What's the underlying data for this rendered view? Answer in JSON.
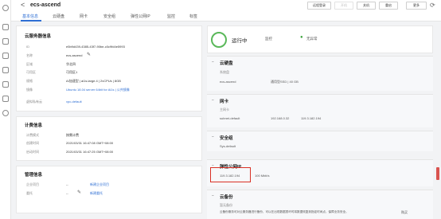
{
  "header": {
    "back": "<",
    "title": "ecs-ascend",
    "buttons": [
      "远程登录",
      "开机",
      "关机",
      "重启",
      "更多"
    ]
  },
  "tabs": [
    "基本信息",
    "云硬盘",
    "网卡",
    "安全组",
    "弹性公网IP",
    "监控",
    "标签"
  ],
  "server_info": {
    "heading": "云服务器信息",
    "rows": [
      {
        "label": "ID",
        "value": "e5b9d439-4385-43f7-90be-c0c9fd4e5993"
      },
      {
        "label": "名称",
        "value": "ecs-ascend"
      },
      {
        "label": "区域",
        "value": "华北四"
      },
      {
        "label": "可用区",
        "value": "可用区1"
      },
      {
        "label": "规格",
        "value": "AI加速型 | ai1s.large.4 | 2vCPUs | 8GB"
      },
      {
        "label": "镜像",
        "value": "Ubuntu 18.04 server 64bit for Ai1s | 公共镜像"
      },
      {
        "label": "虚拟私有云",
        "value": "vpc-default"
      }
    ]
  },
  "billing": {
    "heading": "计费信息",
    "rows": [
      {
        "label": "计费模式",
        "value": "按需计费"
      },
      {
        "label": "创建时间",
        "value": "2021/03/31 16:47:08 GMT+08:00"
      },
      {
        "label": "启动时间",
        "value": "2021/03/31 16:47:25 GMT+08:00"
      }
    ]
  },
  "mgmt": {
    "heading": "管理信息",
    "rows": [
      {
        "label": "企业项目",
        "value": "新建企业项目"
      },
      {
        "label": "委托",
        "value": "新建委托"
      }
    ],
    "dash": "--"
  },
  "status": {
    "text": "运行中",
    "monitor": "监控",
    "health": "无异常"
  },
  "disk": {
    "heading": "云硬盘",
    "sub": "系统盘",
    "name": "ecs-ascend",
    "detail": "通用型SSD | 40 GB"
  },
  "nic": {
    "heading": "网卡",
    "sub": "主网卡",
    "subnet": "subnet-default",
    "ip": "192.168.0.32",
    "eip": "119.3.182.194"
  },
  "sg": {
    "heading": "安全组",
    "name": "Sys-default"
  },
  "eip_section": {
    "heading": "弹性公网IP",
    "ip": "119.3.182.194",
    "bw": "100 Mbit/s"
  },
  "backup": {
    "heading": "云备份",
    "sub": "暂无备份",
    "desc": "云备份服务可对云服务器进行备份，可以在出现数据损坏时将数据恢复到指定时间点，保障业务安全。",
    "link": "购买"
  }
}
